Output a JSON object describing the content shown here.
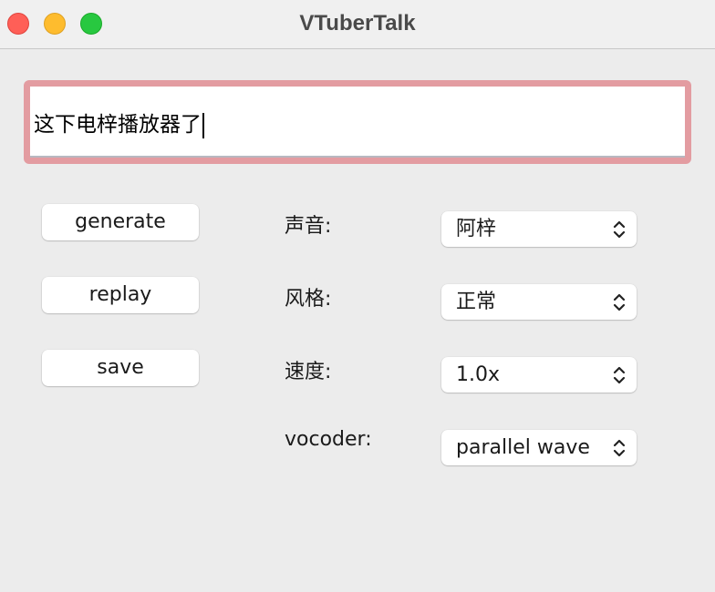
{
  "window": {
    "title": "VTuberTalk"
  },
  "text_input": {
    "value": "这下电梓播放器了"
  },
  "buttons": [
    {
      "label": "generate"
    },
    {
      "label": "replay"
    },
    {
      "label": "save"
    }
  ],
  "settings": [
    {
      "label": "声音:",
      "value": "阿梓"
    },
    {
      "label": "风格:",
      "value": "正常"
    },
    {
      "label": "速度:",
      "value": "1.0x"
    },
    {
      "label": "vocoder:",
      "value": "parallel wave"
    }
  ],
  "colors": {
    "close": "#ff5f57",
    "minimize": "#febc2e",
    "zoom": "#28c840",
    "focus_ring": "#e39ca1"
  }
}
